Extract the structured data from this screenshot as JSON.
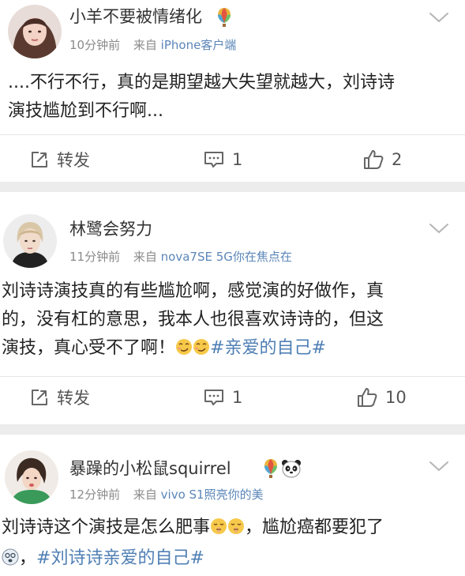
{
  "posts": [
    {
      "username": "小羊不要被情绪化",
      "time": "10分钟前",
      "source_prefix": "来自",
      "source": "iPhone客户端",
      "content_lines": [
        "....不行不行，真的是期望越大失望就越大，刘诗诗",
        "演技尴尬到不行啊..."
      ],
      "badges": [
        "balloon-badge-icon"
      ],
      "actions": {
        "repost": "转发",
        "comments": "1",
        "likes": "2"
      }
    },
    {
      "username": "林鹭会努力",
      "time": "11分钟前",
      "source_prefix": "来自",
      "source": "nova7SE 5G你在焦点在",
      "content_lines": [
        "刘诗诗演技真的有些尴尬啊，感觉演的好做作，真",
        "的，没有杠的意思，我本人也很喜欢诗诗的，但这"
      ],
      "content_line3_text": "演技，真心受不了啊！",
      "content_line3_hashtag": "#亲爱的自己#",
      "badges": [],
      "actions": {
        "repost": "转发",
        "comments": "1",
        "likes": "10"
      }
    },
    {
      "username": "暴躁的小松鼠squirrel",
      "time": "12分钟前",
      "source_prefix": "来自",
      "source": "vivo S1照亮你的美",
      "content_line1_a": "刘诗诗这个演技是怎么肥事",
      "content_line1_b": "，尴尬癌都要犯了",
      "content_line2_a": "，",
      "content_line2_hashtag": "#刘诗诗亲爱的自己#",
      "badges": [
        "balloon-badge-icon",
        "panda-badge-icon"
      ]
    }
  ],
  "colors": {
    "link": "#5b86b8",
    "hashtag": "#4f7fb4",
    "separator": "#ececec",
    "meta": "#8a8a8a"
  }
}
